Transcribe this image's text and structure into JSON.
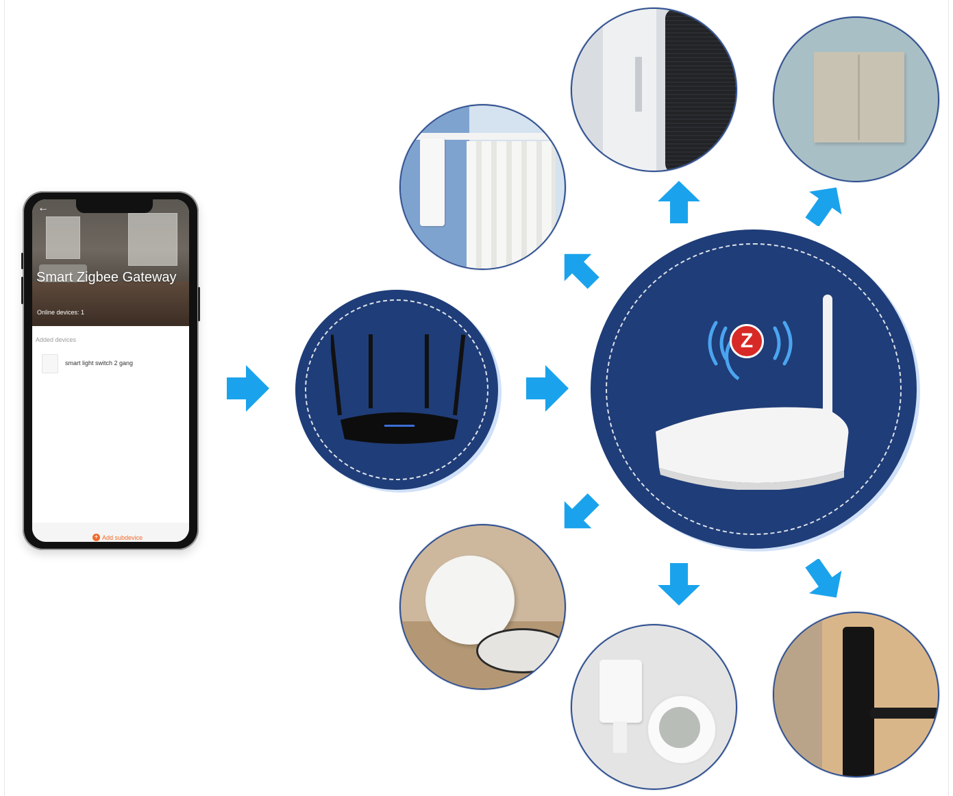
{
  "phone": {
    "title": "Smart Zigbee Gateway",
    "online_devices": "Online devices: 1",
    "added_devices_label": "Added devices",
    "device_name": "smart light switch 2 gang",
    "add_subdevice": "Add subdevice",
    "back_icon": "back-arrow-icon"
  },
  "hub": {
    "logo_letter": "Z",
    "logo_icon": "zigbee-logo-icon"
  },
  "colors": {
    "arrow_blue": "#1aa3ec",
    "navy": "#1f3d78",
    "halo": "#cfe0f8",
    "zigbee_red": "#d72a26",
    "accent_orange": "#f06a2b"
  },
  "devices": [
    "curtain-motor-icon",
    "solar-panel-curtain-icon",
    "wall-switch-icon",
    "door-sensor-icon",
    "motion-thermo-sensor-icon",
    "smart-lock-icon"
  ]
}
